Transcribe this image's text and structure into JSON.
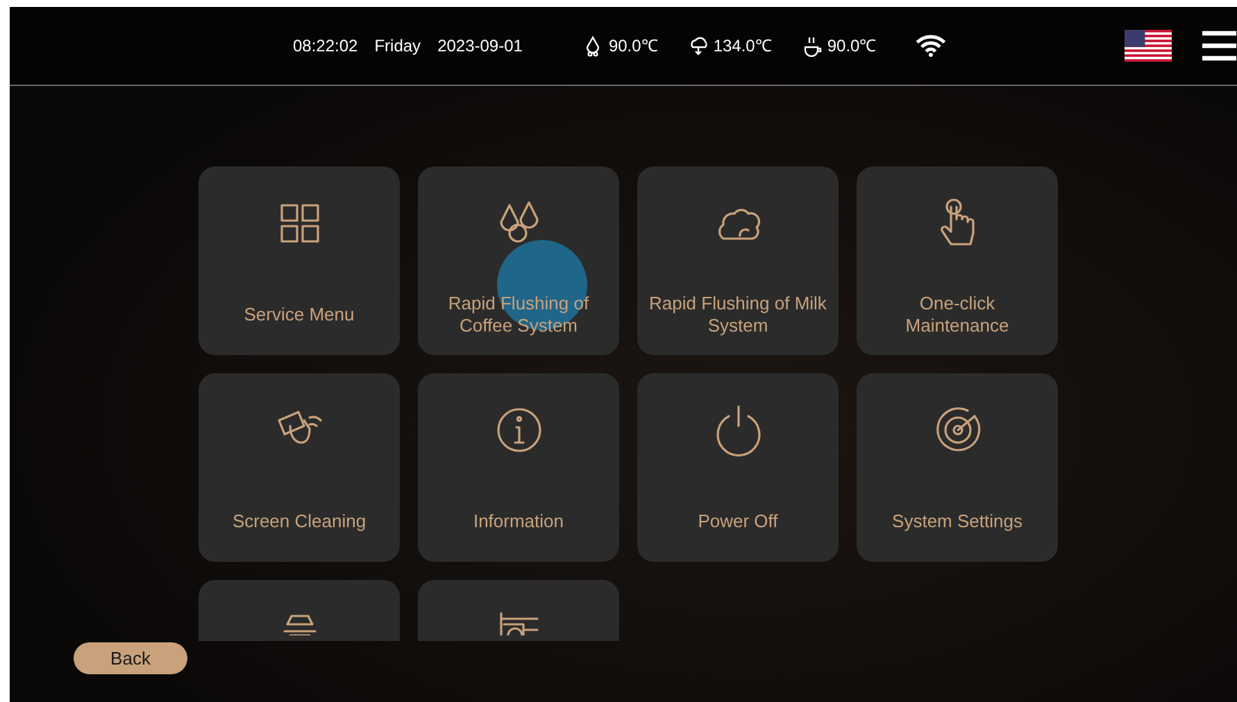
{
  "status_bar": {
    "time": "08:22:02",
    "day": "Friday",
    "date": "2023-09-01",
    "temperatures": [
      {
        "kind": "drops",
        "value": "90.0℃"
      },
      {
        "kind": "steam",
        "value": "134.0℃"
      },
      {
        "kind": "cup",
        "value": "90.0℃"
      }
    ]
  },
  "tiles": [
    {
      "kind": "grid",
      "label": "Service Menu"
    },
    {
      "kind": "drops",
      "label": "Rapid Flushing of Coffee System"
    },
    {
      "kind": "foam",
      "label": "Rapid Flushing of Milk System"
    },
    {
      "kind": "touch",
      "label": "One-click Maintenance"
    },
    {
      "kind": "wipe",
      "label": "Screen Cleaning"
    },
    {
      "kind": "info",
      "label": "Information"
    },
    {
      "kind": "power",
      "label": "Power Off"
    },
    {
      "kind": "target",
      "label": "System Settings"
    },
    {
      "kind": "funnel"
    },
    {
      "kind": "machine"
    }
  ],
  "back_button": "Back"
}
